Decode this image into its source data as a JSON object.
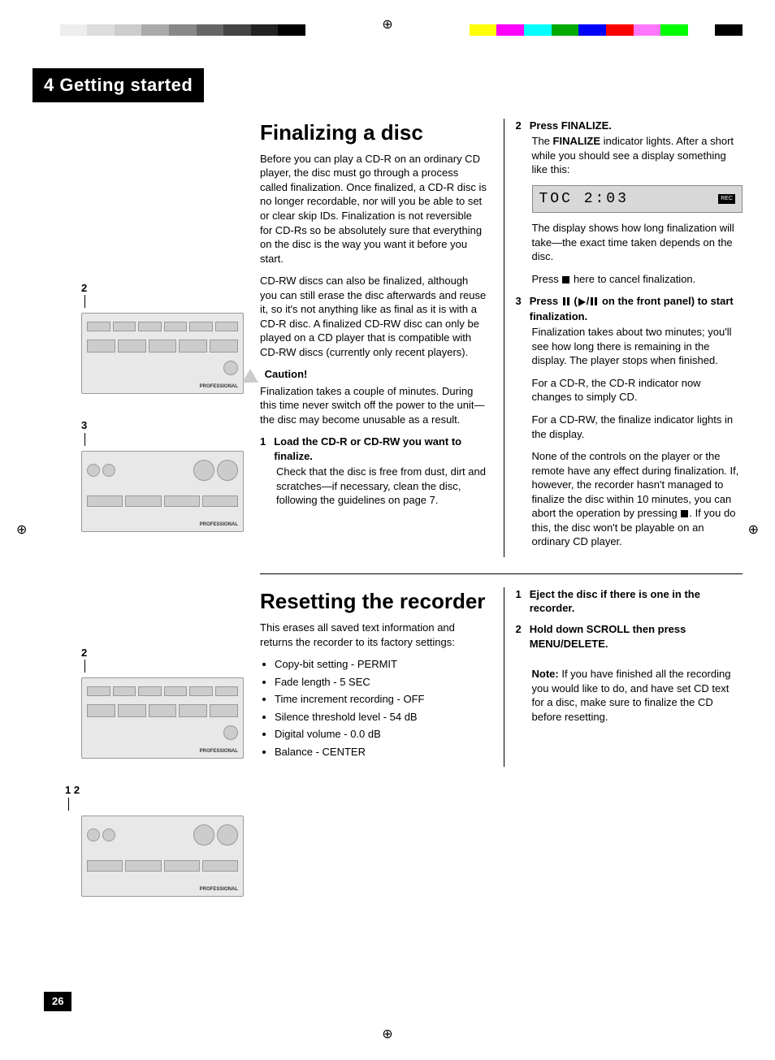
{
  "chapter": "4 Getting started",
  "page_number": "26",
  "section1": {
    "heading": "Finalizing a disc",
    "para1": "Before you can play a CD-R on an ordinary CD player, the disc must go through a process called finalization. Once finalized, a CD-R disc is no longer recordable, nor will you be able to set or clear skip IDs. Finalization is not reversible for CD-Rs so be absolutely sure that everything on the disc is the way you want it before you start.",
    "para2": "CD-RW discs can also be finalized, although you can still erase the disc afterwards and reuse it, so it's not anything like as final as it is with a CD-R disc. A finalized CD-RW disc can only be played on a CD player that is compatible with CD-RW discs (currently only recent players).",
    "caution_head": "Caution!",
    "caution_body": "Finalization takes a couple of minutes. During this time never switch off the power to the unit—the disc may become unusable as a result.",
    "step1_num": "1",
    "step1_head": "Load the CD-R or CD-RW you want to finalize.",
    "step1_body": "Check that the disc is free from dust, dirt and scratches—if necessary, clean the disc, following the guidelines on page 7.",
    "step2_num": "2",
    "step2_head": "Press FINALIZE.",
    "step2_body1a": "The ",
    "step2_body1b": "FINALIZE",
    "step2_body1c": " indicator lights. After a short while you should see a display something like this:",
    "display_text": "TOC  2:03",
    "display_badge": "REC",
    "step2_body2": "The display shows how long finalization will take—the exact time taken depends on the disc.",
    "step2_body3a": "Press ",
    "step2_body3b": " here to cancel finalization.",
    "step3_num": "3",
    "step3_head_a": "Press ",
    "step3_head_b": " (",
    "step3_head_c": " on the front panel) to start finalization.",
    "step3_body1": "Finalization takes about two minutes; you'll see how long there is remaining in the display. The player stops when finished.",
    "step3_body2": "For a CD-R, the CD-R indicator now changes to simply CD.",
    "step3_body3": "For a CD-RW, the finalize indicator lights in the display.",
    "step3_body4a": "None of the controls on the player or the remote have any effect during finalization. If, however, the recorder hasn't managed to finalize the disc within 10 minutes, you can abort the operation by pressing ",
    "step3_body4b": ". If you do this, the disc won't be playable on an ordinary CD player.",
    "img1_label": "2",
    "img2_label": "3"
  },
  "section2": {
    "heading": "Resetting the recorder",
    "para1": "This erases all saved text information and returns the recorder to its factory settings:",
    "bullets": [
      "Copy-bit setting - PERMIT",
      "Fade length - 5 SEC",
      "Time increment recording - OFF",
      "Silence threshold level -  54 dB",
      "Digital volume - 0.0 dB",
      "Balance - CENTER"
    ],
    "step1_num": "1",
    "step1_head": "Eject the disc if there is one in the recorder.",
    "step2_num": "2",
    "step2_head": "Hold down SCROLL then press MENU/DELETE.",
    "note_label": "Note:",
    "note_body": " If you have finished all the recording you would like to do, and have set CD text for a disc, make sure to finalize the CD before resetting.",
    "img1_label": "2",
    "img2_label": "1   2"
  },
  "device_footer": "PROFESSIONAL"
}
